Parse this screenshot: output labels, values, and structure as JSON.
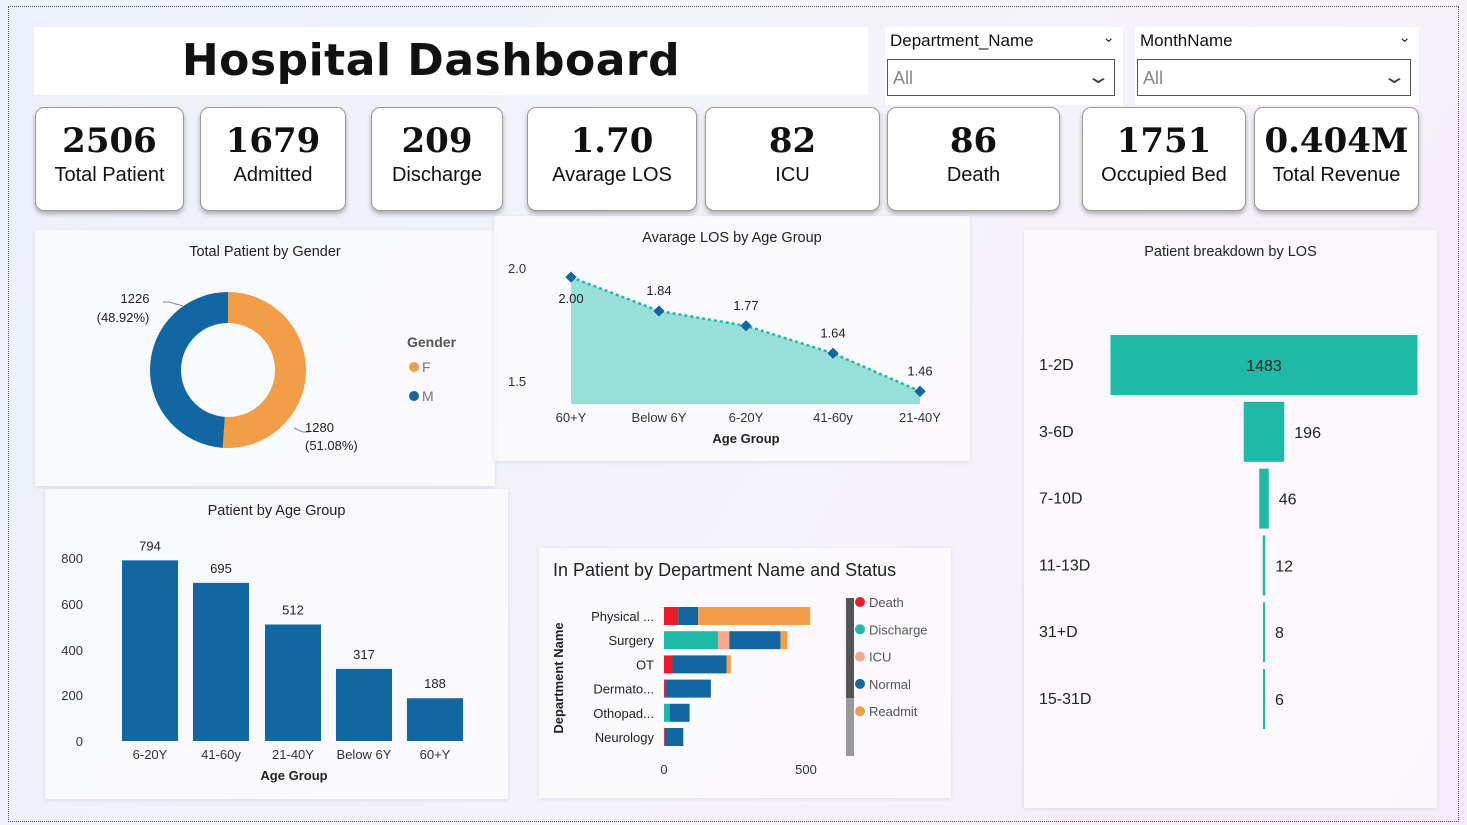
{
  "header": {
    "title": "Hospital Dashboard"
  },
  "filters": [
    {
      "label": "Department_Name",
      "value": "All"
    },
    {
      "label": "MonthName",
      "value": "All"
    }
  ],
  "kpis": [
    {
      "value": "2506",
      "label": "Total Patient"
    },
    {
      "value": "1679",
      "label": "Admitted"
    },
    {
      "value": "209",
      "label": "Discharge"
    },
    {
      "value": "1.70",
      "label": "Avarage LOS"
    },
    {
      "value": "82",
      "label": "ICU"
    },
    {
      "value": "86",
      "label": "Death"
    },
    {
      "value": "1751",
      "label": "Occupied Bed"
    },
    {
      "value": "0.404M",
      "label": "Total Revenue"
    }
  ],
  "colors": {
    "F": "#F29D48",
    "M": "#1266A2",
    "teal": "#1DBAA7",
    "area": "#99DFD9",
    "death": "#EE1C25",
    "icu": "#F4A98C"
  },
  "chart_data": [
    {
      "type": "pie",
      "title": "Total Patient by Gender",
      "legend_title": "Gender",
      "categories": [
        "F",
        "M"
      ],
      "values": [
        1280,
        1226
      ],
      "labels": [
        "1280",
        "1226"
      ],
      "percent_labels": [
        "(51.08%)",
        "(48.92%)"
      ]
    },
    {
      "type": "area",
      "title": "Avarage LOS by Age Group",
      "xlabel": "Age Group",
      "categories": [
        "60+Y",
        "Below 6Y",
        "6-20Y",
        "41-60y",
        "21-40Y"
      ],
      "values": [
        2.0,
        1.84,
        1.77,
        1.64,
        1.46
      ],
      "labels": [
        "2.00",
        "1.84",
        "1.77",
        "1.64",
        "1.46"
      ],
      "yticks": [
        "2.0",
        "1.5"
      ],
      "ylim": [
        1.4,
        2.1
      ]
    },
    {
      "type": "bar",
      "title": "Patient breakdown by LOS",
      "orientation": "horizontal",
      "categories": [
        "1-2D",
        "3-6D",
        "7-10D",
        "11-13D",
        "31+D",
        "15-31D"
      ],
      "values": [
        1483,
        196,
        46,
        12,
        8,
        6
      ],
      "labels": [
        "1483",
        "196",
        "46",
        "12",
        "8",
        "6"
      ]
    },
    {
      "type": "bar",
      "title": "Patient by Age Group",
      "xlabel": "Age Group",
      "categories": [
        "6-20Y",
        "41-60y",
        "21-40Y",
        "Below 6Y",
        "60+Y"
      ],
      "values": [
        794,
        695,
        512,
        317,
        188
      ],
      "labels": [
        "794",
        "695",
        "512",
        "317",
        "188"
      ],
      "yticks": [
        "800",
        "600",
        "400",
        "200",
        "0"
      ],
      "ylim": [
        0,
        800
      ]
    },
    {
      "type": "bar",
      "stacked": true,
      "orientation": "horizontal",
      "title": "In Patient by Department Name and Status",
      "ylabel": "Department Name",
      "categories": [
        "Physical ...",
        "Surgery",
        "OT",
        "Dermato...",
        "Othopad...",
        "Neurology"
      ],
      "xticks": [
        "0",
        "500"
      ],
      "xlim": [
        0,
        500
      ],
      "series": [
        {
          "name": "Death",
          "values": [
            50,
            0,
            30,
            5,
            0,
            3
          ]
        },
        {
          "name": "Discharge",
          "values": [
            0,
            190,
            0,
            0,
            20,
            0
          ]
        },
        {
          "name": "ICU",
          "values": [
            0,
            40,
            0,
            0,
            0,
            0
          ]
        },
        {
          "name": "Normal",
          "values": [
            70,
            180,
            190,
            160,
            70,
            65
          ]
        },
        {
          "name": "Readmit",
          "values": [
            395,
            25,
            15,
            0,
            0,
            0
          ]
        }
      ]
    }
  ]
}
